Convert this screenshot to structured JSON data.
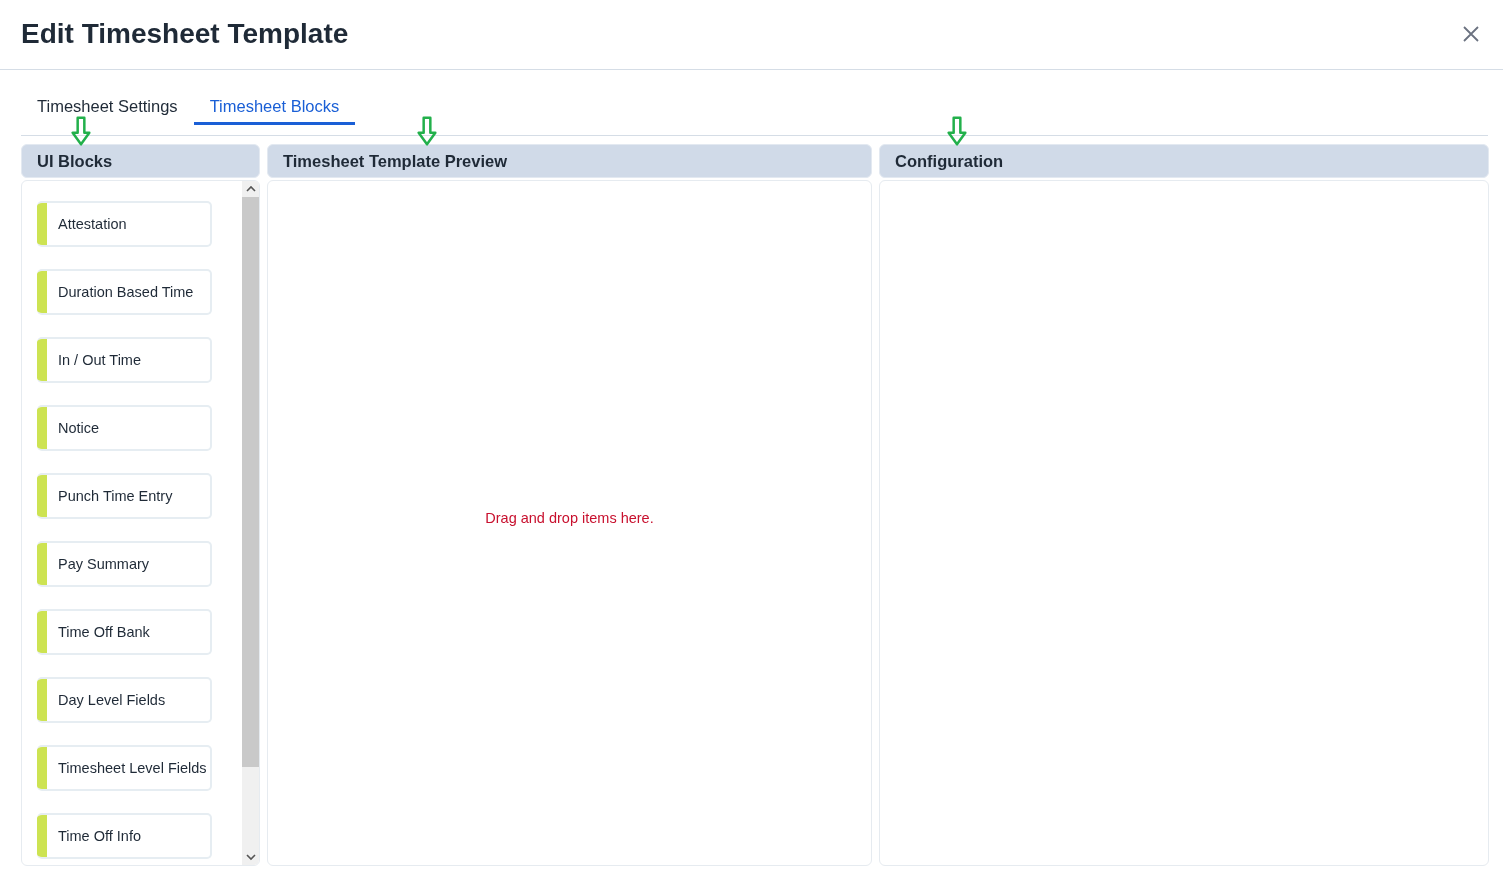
{
  "dialog": {
    "title": "Edit Timesheet Template"
  },
  "tabs": [
    {
      "label": "Timesheet Settings",
      "selected": false
    },
    {
      "label": "Timesheet Blocks",
      "selected": true
    }
  ],
  "panels": [
    {
      "kind": "blocks",
      "title": "UI Blocks",
      "items": [
        "Attestation",
        "Duration Based Time",
        "In / Out Time",
        "Notice",
        "Punch Time Entry",
        "Pay Summary",
        "Time Off Bank",
        "Day Level Fields",
        "Timesheet Level Fields",
        "Time Off Info"
      ]
    },
    {
      "kind": "preview",
      "title": "Timesheet Template Preview",
      "placeholder": "Drag and drop items here."
    },
    {
      "kind": "config",
      "title": "Configuration"
    }
  ]
}
